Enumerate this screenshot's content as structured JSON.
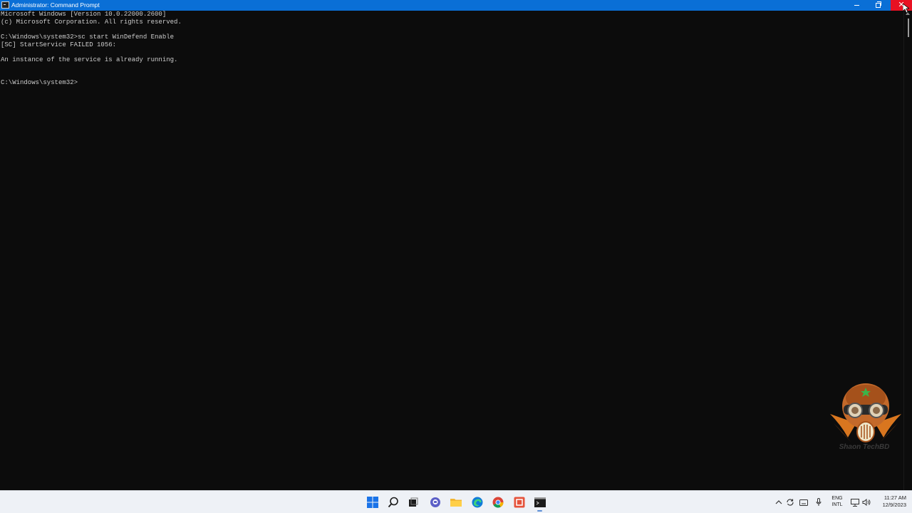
{
  "window": {
    "title": "Administrator: Command Prompt",
    "controls": {
      "minimize": "─",
      "maximize": "□",
      "close": "✕"
    }
  },
  "console": {
    "lines": [
      "Microsoft Windows [Version 10.0.22000.2600]",
      "(c) Microsoft Corporation. All rights reserved.",
      "",
      "C:\\Windows\\system32>sc start WinDefend Enable",
      "[SC] StartService FAILED 1056:",
      "",
      "An instance of the service is already running.",
      "",
      "",
      "C:\\Windows\\system32>"
    ]
  },
  "watermark": {
    "text": "Shaon TechBD"
  },
  "taskbar": {
    "icons": [
      "windows-start-icon",
      "search-icon",
      "task-view-icon",
      "chat-icon",
      "file-explorer-icon",
      "edge-icon",
      "chrome-icon",
      "app-icon",
      "command-prompt-icon"
    ],
    "tray": {
      "lang_primary": "ENG",
      "lang_secondary": "INTL",
      "time": "11:27 AM",
      "date": "12/9/2023"
    }
  },
  "colors": {
    "titlebar": "#0a6fd6",
    "console_bg": "#0c0c0c",
    "console_text": "#cccccc",
    "close_hover": "#e81123",
    "taskbar": "#eef1f6"
  }
}
